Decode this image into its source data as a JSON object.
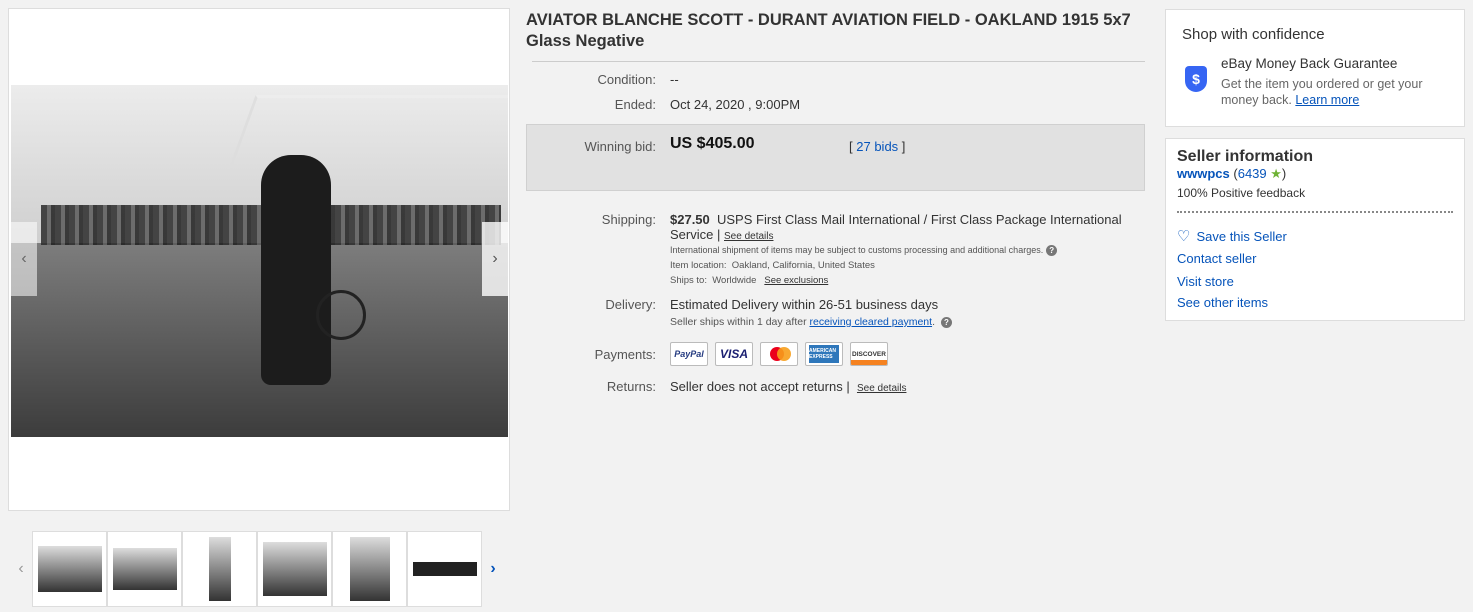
{
  "listing": {
    "title": "AVIATOR BLANCHE SCOTT - DURANT AVIATION FIELD - OAKLAND 1915 5x7 Glass Negative"
  },
  "gallery": {
    "prev_arrow": "‹",
    "next_arrow": "›",
    "thumb_prev": "‹",
    "thumb_next": "›",
    "thumb_count": 6
  },
  "details": {
    "condition_label": "Condition:",
    "condition_value": "--",
    "ended_label": "Ended:",
    "ended_value": "Oct 24, 2020 , 9:00PM",
    "winning_label": "Winning bid:",
    "winning_value": "US $405.00",
    "bids_open": "[",
    "bids_link": "27 bids",
    "bids_close": "]",
    "shipping_label": "Shipping:",
    "shipping_price": "$27.50",
    "shipping_service": "USPS First Class Mail International / First Class Package International Service",
    "shipping_sep": "|",
    "see_details": "See details",
    "intl_note": "International shipment of items may be subject to customs processing and additional charges.",
    "item_location_label": "Item location:",
    "item_location": "Oakland, California, United States",
    "ships_to_label": "Ships to:",
    "ships_to": "Worldwide",
    "see_exclusions": "See exclusions",
    "delivery_label": "Delivery:",
    "delivery_value": "Estimated Delivery within 26-51 business days",
    "handling_pre": "Seller ships within 1 day after",
    "handling_link": "receiving cleared payment",
    "handling_post": ".",
    "payments_label": "Payments:",
    "pay_paypal": "PayPal",
    "pay_visa": "VISA",
    "pay_amex": "AMERICAN EXPRESS",
    "pay_discover": "DISCOVER",
    "returns_label": "Returns:",
    "returns_value": "Seller does not accept returns",
    "returns_sep": "|",
    "returns_details": "See details"
  },
  "confidence": {
    "title": "Shop with confidence",
    "shield_glyph": "$",
    "guarantee": "eBay Money Back Guarantee",
    "text": "Get the item you ordered or get your money back.",
    "learn_more": "Learn more"
  },
  "seller": {
    "title": "Seller information",
    "name": "wwwpcs",
    "score_open": "(",
    "score": "6439",
    "score_close": ")",
    "star": "★",
    "feedback": "100% Positive feedback",
    "save": "Save this Seller",
    "contact": "Contact seller",
    "store": "Visit store",
    "other": "See other items"
  },
  "colors": {
    "link": "#0654ba",
    "bid_box": "#e1e1e1",
    "star": "#6fb235"
  }
}
